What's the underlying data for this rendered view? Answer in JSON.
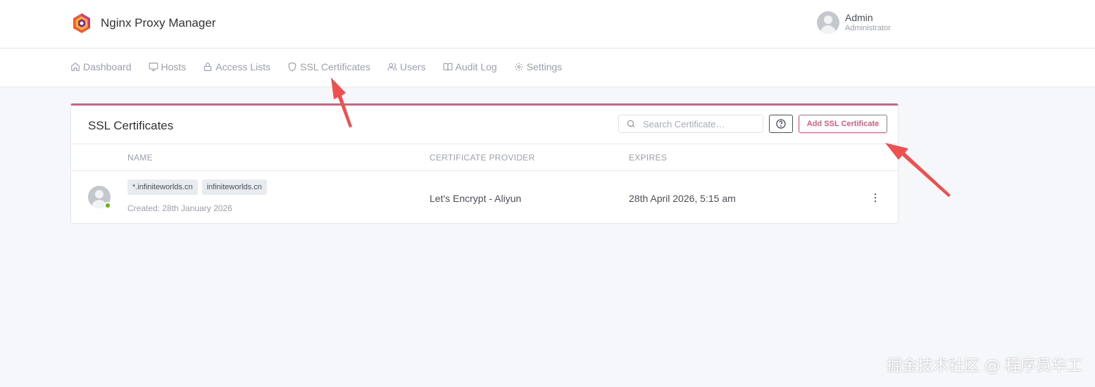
{
  "app": {
    "title": "Nginx Proxy Manager"
  },
  "user": {
    "name": "Admin",
    "role": "Administrator"
  },
  "nav": [
    {
      "label": "Dashboard",
      "icon": "home-icon"
    },
    {
      "label": "Hosts",
      "icon": "monitor-icon"
    },
    {
      "label": "Access Lists",
      "icon": "lock-icon"
    },
    {
      "label": "SSL Certificates",
      "icon": "shield-icon"
    },
    {
      "label": "Users",
      "icon": "users-icon"
    },
    {
      "label": "Audit Log",
      "icon": "book-icon"
    },
    {
      "label": "Settings",
      "icon": "gear-icon"
    }
  ],
  "card": {
    "title": "SSL Certificates",
    "search_placeholder": "Search Certificate…",
    "add_label": "Add SSL Certificate"
  },
  "table": {
    "headers": {
      "name": "NAME",
      "provider": "CERTIFICATE PROVIDER",
      "expires": "EXPIRES"
    },
    "rows": [
      {
        "domains": [
          "*.infiniteworlds.cn",
          "infiniteworlds.cn"
        ],
        "created": "Created: 28th January 2026",
        "provider": "Let's Encrypt - Aliyun",
        "expires": "28th April 2026, 5:15 am",
        "status": "online"
      }
    ]
  },
  "watermark": "掘金技术社区 @ 程序员华工",
  "colors": {
    "accent": "#e1597f",
    "online": "#5eba00",
    "arrow": "#ef4f4f"
  }
}
